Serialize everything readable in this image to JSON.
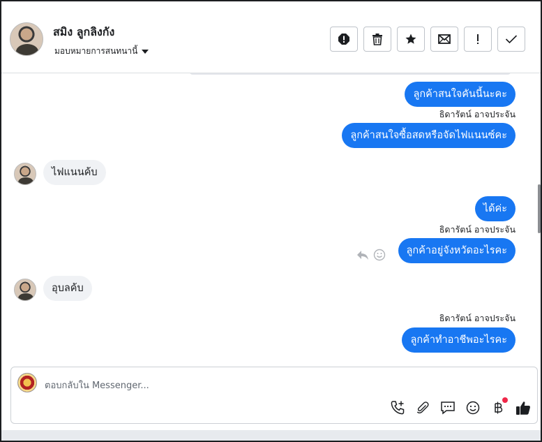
{
  "header": {
    "contact_name": "สมิง ลูกลิงกัง",
    "assign_label": "มอบหมายการสนทนานี้",
    "icons": [
      "spam-icon",
      "trash-icon",
      "star-icon",
      "envelope-icon",
      "exclamation-icon",
      "check-icon"
    ]
  },
  "messages": [
    {
      "dir": "out",
      "text": "ลูกค้าสนใจคันนี้นะคะ"
    },
    {
      "dir": "sender",
      "text": "ธิดารัตน์ อาจประจัน"
    },
    {
      "dir": "out",
      "text": "ลูกค้าสนใจซื้อสดหรือจัดไฟแนนซ์คะ"
    },
    {
      "dir": "in",
      "text": "ไฟแนนค้บ"
    },
    {
      "dir": "out",
      "text": "ได้ค่ะ"
    },
    {
      "dir": "sender",
      "text": "ธิดารัตน์ อาจประจัน"
    },
    {
      "dir": "out",
      "text": "ลูกค้าอยู่จังหวัดอะไรคะ"
    },
    {
      "dir": "in",
      "text": "อุบลค้บ"
    },
    {
      "dir": "sender",
      "text": "ธิดารัตน์ อาจประจัน"
    },
    {
      "dir": "out",
      "text": "ลูกค้าทำอาชีพอะไรคะ"
    }
  ],
  "composer": {
    "placeholder": "ตอบกลับใน Messenger...",
    "icons": [
      "call-plus-icon",
      "paperclip-icon",
      "chat-bubble-icon",
      "emoji-icon",
      "baht-icon",
      "thumbs-up-icon"
    ]
  }
}
